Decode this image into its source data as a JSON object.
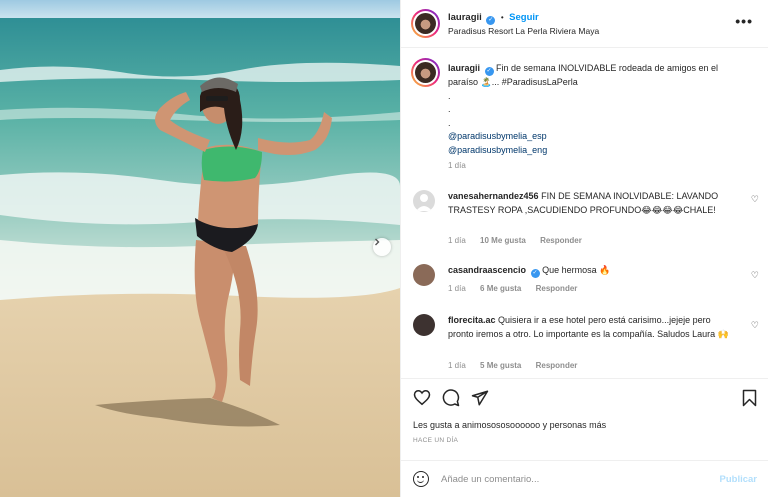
{
  "post": {
    "username": "lauragii",
    "follow_label": "Seguir",
    "separator": "•",
    "location": "Paradisus Resort La Perla Riviera Maya",
    "more_label": "•••",
    "caption_user": "lauragii",
    "caption_text": "Fin de semana INOLVIDABLE rodeada de amigos en el paraíso 🏝️... #ParadisusLaPerla",
    "caption_dots": [
      ".",
      ".",
      "."
    ],
    "mention_1": "@paradisusbymelia_esp",
    "mention_2": "@paradisusbymelia_eng",
    "caption_time": "1 día"
  },
  "comments": [
    {
      "user": "vanesahernandez456",
      "text": "FIN DE SEMANA INOLVIDABLE: LAVANDO TRASTESY ROPA ,SACUDIENDO PROFUNDO😂😂😂😂CHALE!",
      "time": "1 día",
      "likes": "10 Me gusta",
      "reply": "Responder"
    },
    {
      "user": "casandraascencio",
      "text": "Que hermosa 🔥",
      "time": "1 día",
      "likes": "6 Me gusta",
      "reply": "Responder"
    },
    {
      "user": "florecita.ac",
      "text": "Quisiera ir a ese hotel pero está carisimo...jejeje pero pronto iremos a otro. Lo importante es la compañía. Saludos Laura 🙌",
      "time": "1 día",
      "likes": "5 Me gusta",
      "reply": "Responder"
    }
  ],
  "likes_text": "Les gusta a animosososoooooo y personas más",
  "post_date": "HACE UN DÍA",
  "add_comment": {
    "placeholder": "Añade un comentario...",
    "publish_label": "Publicar"
  },
  "colors": {
    "accent": "#0095f6",
    "verified": "#3897f0",
    "mention": "#00376b",
    "muted": "#8e8e8e"
  },
  "icons": [
    "next-arrow-icon",
    "more-icon",
    "verified-icon",
    "heart-icon",
    "comment-icon",
    "share-icon",
    "bookmark-icon",
    "emoji-icon"
  ]
}
